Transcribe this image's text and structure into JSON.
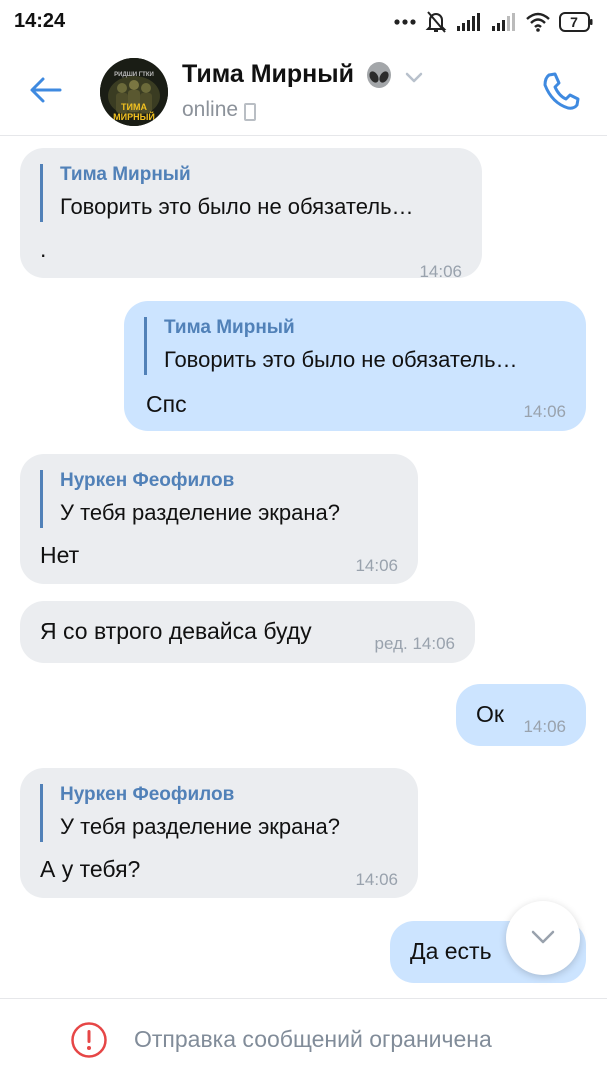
{
  "status_bar": {
    "time": "14:24",
    "battery_level": "7",
    "icons": [
      "dots-icon",
      "muted-bell-icon",
      "signal-icon",
      "signal-icon",
      "wifi-icon",
      "battery-icon"
    ]
  },
  "header": {
    "title": "Тима Мирный",
    "title_emoji": "alien-emoji",
    "status": "online",
    "avatar_text_top": "РИДШИ ГТКИ",
    "avatar_text_main": "ТИМА МИРНЫЙ"
  },
  "messages": [
    {
      "direction": "in",
      "reply_author": "Тима Мирный",
      "reply_text": "Говорить это было не обязатель…",
      "text": ".",
      "time": "14:06"
    },
    {
      "direction": "out",
      "reply_author": "Тима Мирный",
      "reply_text": "Говорить это было не обязатель…",
      "text": "Спс",
      "time": "14:06"
    },
    {
      "direction": "in",
      "reply_author": "Нуркен Феофилов",
      "reply_text": "У тебя разделение экрана?",
      "text": "Нет",
      "time": "14:06"
    },
    {
      "direction": "in",
      "text": "Я со втрого девайса буду",
      "time": "ред. 14:06"
    },
    {
      "direction": "out",
      "text": "Ок",
      "time": "14:06"
    },
    {
      "direction": "in",
      "reply_author": "Нуркен Феофилов",
      "reply_text": "У тебя разделение экрана?",
      "text": "А у тебя?",
      "time": "14:06"
    },
    {
      "direction": "out",
      "text": "Да есть"
    }
  ],
  "footer": {
    "text": "Отправка сообщений ограничена"
  },
  "colors": {
    "accent": "#5181b8",
    "incoming_bubble": "#ebedf0",
    "outgoing_bubble": "#cce4ff",
    "warning": "#e64646"
  }
}
